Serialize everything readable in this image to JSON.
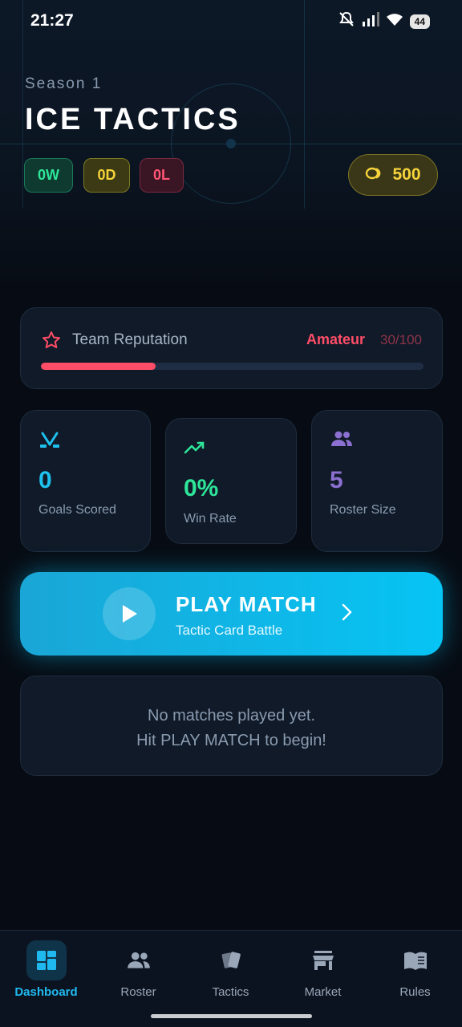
{
  "status_bar": {
    "time": "21:27",
    "battery": "44"
  },
  "header": {
    "season": "Season 1",
    "title": "ICE TACTICS",
    "record": {
      "wins": "0W",
      "draws": "0D",
      "losses": "0L"
    },
    "coins": "500"
  },
  "colors": {
    "accent": "#06c4f4",
    "win": "#2ee69a",
    "draw": "#f4d23a",
    "loss": "#ff4d67",
    "coin": "#f6d33b",
    "purple": "#8b6fd1"
  },
  "reputation": {
    "label": "Team Reputation",
    "rank": "Amateur",
    "score": "30/100",
    "progress": 0.3
  },
  "stats": [
    {
      "icon": "hockey-sticks-icon",
      "value": "0",
      "label": "Goals Scored",
      "color": "#1ec0ee"
    },
    {
      "icon": "trending-up-icon",
      "value": "0%",
      "label": "Win Rate",
      "color": "#2ee69a"
    },
    {
      "icon": "people-icon",
      "value": "5",
      "label": "Roster Size",
      "color": "#8b6fd1"
    }
  ],
  "play_match": {
    "title": "PLAY MATCH",
    "subtitle": "Tactic Card Battle"
  },
  "empty_state": {
    "line1": "No matches played yet.",
    "line2": "Hit PLAY MATCH to begin!"
  },
  "nav": [
    {
      "label": "Dashboard",
      "icon": "grid-icon",
      "active": true
    },
    {
      "label": "Roster",
      "icon": "people-icon"
    },
    {
      "label": "Tactics",
      "icon": "cards-icon"
    },
    {
      "label": "Market",
      "icon": "store-icon"
    },
    {
      "label": "Rules",
      "icon": "book-icon"
    }
  ]
}
